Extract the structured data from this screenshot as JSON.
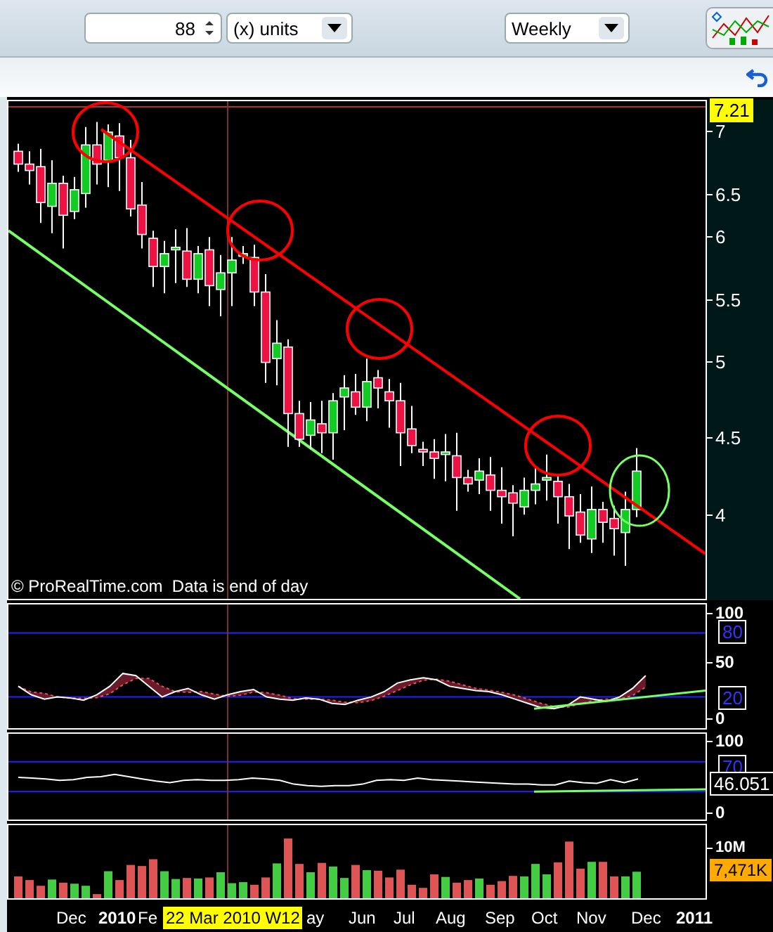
{
  "toolbar": {
    "units_count": "88",
    "units_select": "(x) units",
    "period_select": "Weekly"
  },
  "price_pane": {
    "last_price": "7.21",
    "axis_ticks": [
      "7",
      "6.5",
      "6",
      "5.5",
      "5",
      "4.5",
      "4"
    ],
    "source_note": "© ProRealTime.com  Data is end of day"
  },
  "stochastic_pane": {
    "axis_ticks": [
      {
        "label": "100",
        "kind": "plain"
      },
      {
        "label": "80",
        "kind": "boxed"
      },
      {
        "label": "50",
        "kind": "plain"
      },
      {
        "label": "20",
        "kind": "boxed"
      },
      {
        "label": "0",
        "kind": "plain"
      }
    ]
  },
  "rsi_pane": {
    "axis_ticks": [
      {
        "label": "100",
        "kind": "plain"
      },
      {
        "label": "70",
        "kind": "boxed"
      },
      {
        "label": "0",
        "kind": "plain"
      }
    ],
    "current_value": "46.051"
  },
  "volume_pane": {
    "axis_ticks": [
      {
        "label": "10M",
        "kind": "plain"
      }
    ],
    "current_value": "7,471K"
  },
  "time_axis": {
    "labels": [
      {
        "text": "Dec",
        "kind": "month"
      },
      {
        "text": "2010",
        "kind": "year"
      },
      {
        "text": "Fe",
        "kind": "month"
      },
      {
        "text": "ay",
        "kind": "month"
      },
      {
        "text": "Jun",
        "kind": "month"
      },
      {
        "text": "Jul",
        "kind": "month"
      },
      {
        "text": "Aug",
        "kind": "month"
      },
      {
        "text": "Sep",
        "kind": "month"
      },
      {
        "text": "Oct",
        "kind": "month"
      },
      {
        "text": "Nov",
        "kind": "month"
      },
      {
        "text": "Dec",
        "kind": "month"
      },
      {
        "text": "2011",
        "kind": "year"
      }
    ],
    "cursor_label": "22 Mar 2010 W12"
  }
}
